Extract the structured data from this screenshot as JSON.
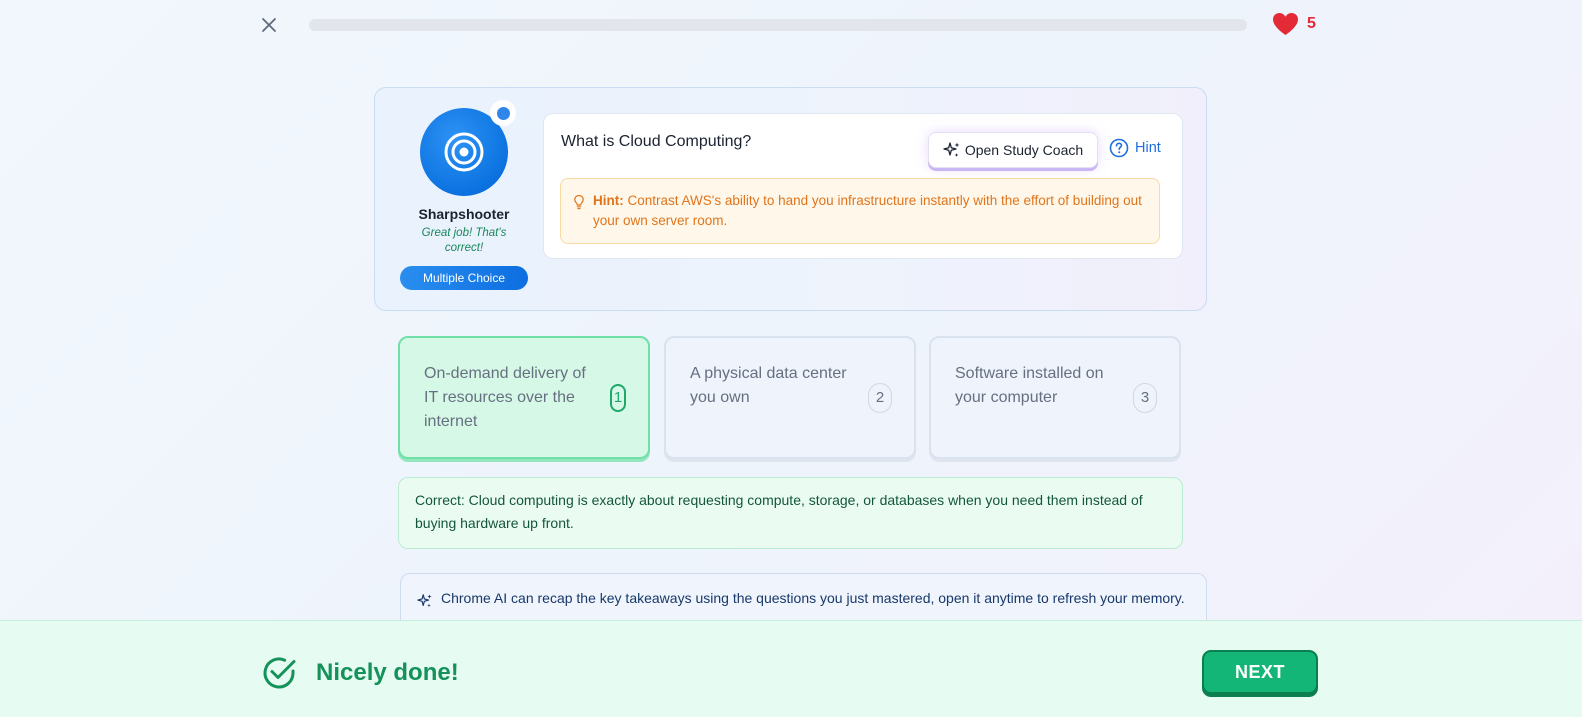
{
  "top_bar": {
    "progress": 0,
    "hearts_count": "5",
    "heart_color": "#e32a36"
  },
  "badge": {
    "name": "Sharpshooter",
    "message": "Great job! That's correct!",
    "question_type": "Multiple Choice",
    "icon": "target-icon",
    "color": "#0c72e0"
  },
  "question": {
    "text": "What is Cloud Computing?",
    "study_coach_label": "Open Study Coach",
    "hint_label": "Hint",
    "hint_prefix": "Hint:",
    "hint_text": "Contrast AWS's ability to hand you infrastructure instantly with the effort of building out your own server room."
  },
  "answers": [
    {
      "text": "On-demand delivery of IT resources over the internet",
      "number": "1",
      "state": "correct"
    },
    {
      "text": "A physical data center you own",
      "number": "2",
      "state": "default"
    },
    {
      "text": "Software installed on your computer",
      "number": "3",
      "state": "default"
    }
  ],
  "feedback": {
    "text": "Correct: Cloud computing is exactly about requesting compute, storage, or databases when you need them instead of buying hardware up front."
  },
  "ai_recap": {
    "text": "Chrome AI can recap the key takeaways using the questions you just mastered, open it anytime to refresh your memory."
  },
  "footer": {
    "status_text": "Nicely done!",
    "next_label": "NEXT",
    "accent_color": "#13b676"
  }
}
